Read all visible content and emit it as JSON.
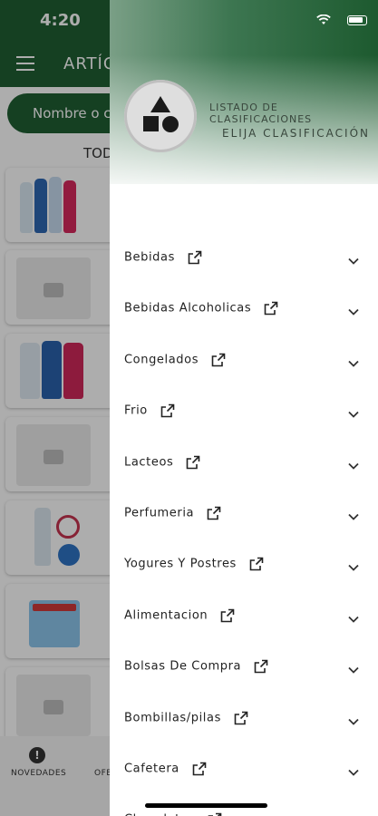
{
  "status_bar": {
    "time": "4:20"
  },
  "app": {
    "title": "ARTÍC",
    "search_placeholder": "Nombre o có",
    "tab_label": "TOD",
    "bottom_nav": [
      {
        "label": "NOVEDADES",
        "icon": "alert-circle-icon",
        "glyph": "!"
      },
      {
        "label": "OFE",
        "icon": "tag-icon"
      }
    ]
  },
  "drawer": {
    "header": {
      "title": "LISTADO DE CLASIFICACIONES",
      "subtitle": "ELIJA CLASIFICACIÓN",
      "logo_icon": "shapes-icon"
    },
    "categories": [
      {
        "label": "Bebidas"
      },
      {
        "label": "Bebidas Alcoholicas"
      },
      {
        "label": "Congelados"
      },
      {
        "label": "Frio"
      },
      {
        "label": "Lacteos"
      },
      {
        "label": "Perfumeria"
      },
      {
        "label": "Yogures Y Postres"
      },
      {
        "label": "Alimentacion"
      },
      {
        "label": "Bolsas De Compra"
      },
      {
        "label": "Bombillas/pilas"
      },
      {
        "label": "Cafetera"
      },
      {
        "label": "Chocolates"
      }
    ]
  },
  "colors": {
    "brand_green": "#1f5f33",
    "text_dark": "#222222"
  }
}
